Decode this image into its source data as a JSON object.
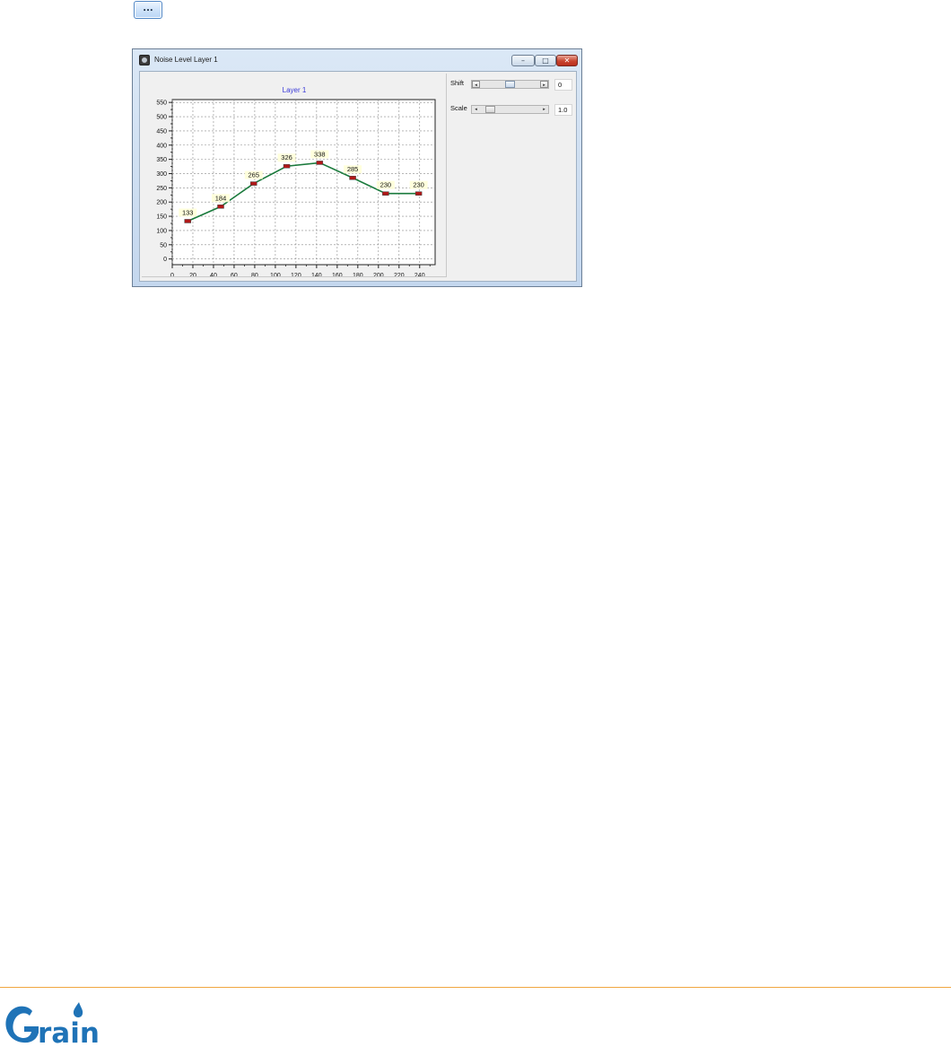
{
  "toolbar": {
    "ellipsis_button_label": "..."
  },
  "window": {
    "title": "Noise Level Layer 1",
    "minimize_symbol": "–",
    "maximize_symbol": "□",
    "close_symbol": "✕"
  },
  "controls": {
    "shift": {
      "label": "Shift",
      "value": "0",
      "thumb_position": 0.5,
      "left_arrow": "◂",
      "right_arrow": "▸"
    },
    "scale": {
      "label": "Scale",
      "value": "1.0",
      "thumb_position": 0.1,
      "left_arrow": "◂",
      "right_arrow": "▸"
    }
  },
  "chart_data": {
    "type": "line",
    "title": "Layer 1",
    "xlabel": "",
    "ylabel": "",
    "x_ticks": [
      0,
      20,
      40,
      60,
      80,
      100,
      120,
      140,
      160,
      180,
      200,
      220,
      240
    ],
    "y_ticks": [
      0,
      50,
      100,
      150,
      200,
      250,
      300,
      350,
      400,
      450,
      500,
      550
    ],
    "xlim": [
      0,
      255
    ],
    "ylim": [
      -20,
      560
    ],
    "grid": true,
    "series": [
      {
        "x": [
          15,
          47,
          79,
          111,
          143,
          175,
          207,
          239
        ],
        "y": [
          133,
          184,
          265,
          326,
          338,
          285,
          230,
          230
        ],
        "labels": [
          "133",
          "184",
          "265",
          "326",
          "338",
          "285",
          "230",
          "230"
        ],
        "line_color": "#1a7a3c",
        "marker_color": "#b01818"
      }
    ],
    "title_color": "#3a3ad8"
  },
  "branding": {
    "logo_text": "rain"
  },
  "colors": {
    "footer_line": "#f0a640",
    "logo_blue": "#1f73b7"
  }
}
